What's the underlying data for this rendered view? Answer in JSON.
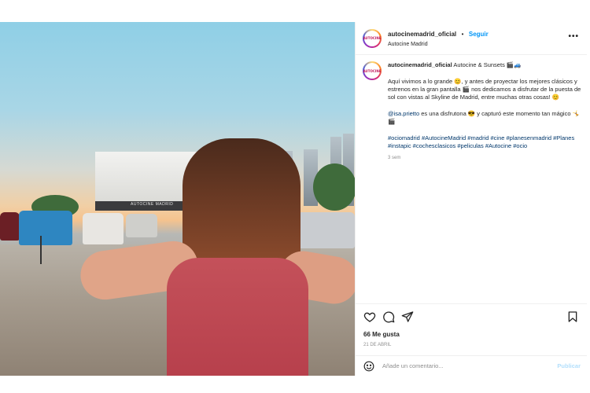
{
  "header": {
    "username": "autocinemadrid_oficial",
    "dot": "•",
    "follow_label": "Seguir",
    "location": "Autocine Madrid",
    "more_label": "•••"
  },
  "photo": {
    "screen_label": "AUTOCINE MADRID"
  },
  "caption": {
    "username": "autocinemadrid_oficial",
    "title": "Autocine & Sunsets 🎬🚙",
    "paragraph1": "Aquí vivimos a lo grande 😊, y antes de proyectar los mejores clásicos y estrenos en la gran pantalla 🎬 nos dedicamos a disfrutar de la puesta de sol con vistas al Skyline de Madrid, entre muchas otras cosas! 😊",
    "mention": "@isa.prietto",
    "paragraph2_rest": " es una disfrutona 😎 y capturó este momento tan mágico 🤸🎬",
    "hashtags": "#ociomadrid #AutocineMadrid #madrid #cine #planesenmadrid #Planes #instapic #cochesclasicos #peliculas #Autocine #ocio",
    "age": "3 sem"
  },
  "actions": {
    "likes": "66 Me gusta",
    "date": "21 de abril"
  },
  "comment": {
    "placeholder": "Añade un comentario...",
    "publish_label": "Publicar"
  },
  "colors": {
    "link": "#0095f6",
    "hashtag": "#00376b",
    "muted": "#8e8e8e",
    "publish_disabled": "#b2dffc"
  }
}
